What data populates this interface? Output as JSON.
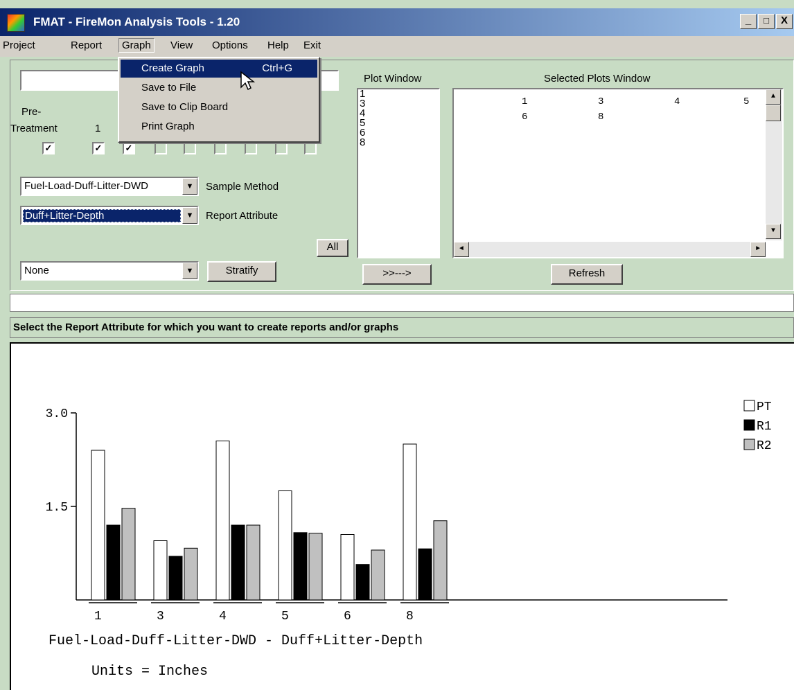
{
  "window": {
    "title": "FMAT - FireMon Analysis Tools  - 1.20",
    "controls": [
      "_",
      "□",
      "X"
    ]
  },
  "menubar": {
    "items": [
      "Project",
      "Report",
      "Graph",
      "View",
      "Options",
      "Help",
      "Exit"
    ],
    "open_menu": "Graph"
  },
  "graph_menu": {
    "items": [
      {
        "label": "Create Graph",
        "shortcut": "Ctrl+G"
      },
      {
        "label": "Save to File",
        "shortcut": ""
      },
      {
        "label": "Save to Clip Board",
        "shortcut": ""
      },
      {
        "label": "Print Graph",
        "shortcut": ""
      }
    ],
    "highlighted": "Create Graph"
  },
  "controls": {
    "top_field_value": "",
    "pretreatment_label_1": "Pre-",
    "pretreatment_label_2": "Treatment",
    "visit_1_label": "1",
    "checkboxes": [
      true,
      true,
      true,
      false,
      false,
      false,
      false,
      false,
      false,
      false
    ],
    "sample_method_value": "Fuel-Load-Duff-Litter-DWD",
    "sample_method_label": "Sample Method",
    "report_attribute_value": "Duff+Litter-Depth",
    "report_attribute_label": "Report Attribute",
    "all_button": "All",
    "stratify_value": "None",
    "stratify_button": "Stratify"
  },
  "plot_window": {
    "label": "Plot Window",
    "items": [
      "1",
      "3",
      "4",
      "5",
      "6",
      "8"
    ],
    "move_button": ">>--->"
  },
  "selected_plots": {
    "label": "Selected Plots Window",
    "rows": [
      [
        "1",
        "3",
        "4",
        "5"
      ],
      [
        "6",
        "8",
        "",
        ""
      ]
    ],
    "refresh_button": "Refresh"
  },
  "status_text": "",
  "prompt": "Select the Report Attribute for which you want to create reports and/or graphs",
  "chart_data": {
    "type": "bar",
    "categories": [
      "1",
      "3",
      "4",
      "5",
      "6",
      "8"
    ],
    "series": [
      {
        "name": "PT",
        "values": [
          2.4,
          0.95,
          2.55,
          1.75,
          1.05,
          2.5
        ],
        "color": "#ffffff"
      },
      {
        "name": "R1",
        "values": [
          1.2,
          0.7,
          1.2,
          1.08,
          0.57,
          0.82
        ],
        "color": "#000000"
      },
      {
        "name": "R2",
        "values": [
          1.47,
          0.83,
          1.2,
          1.07,
          0.8,
          1.27
        ],
        "color": "#c0c0c0"
      }
    ],
    "yticks": [
      1.5,
      3.0
    ],
    "ytick_labels": [
      "1.5",
      "3.0"
    ],
    "ylim": [
      0,
      3.0
    ],
    "xlabel": "Fuel-Load-Duff-Litter-DWD  -  Duff+Litter-Depth",
    "units_label": "Units = Inches",
    "legend_position": "right",
    "grid": false
  }
}
